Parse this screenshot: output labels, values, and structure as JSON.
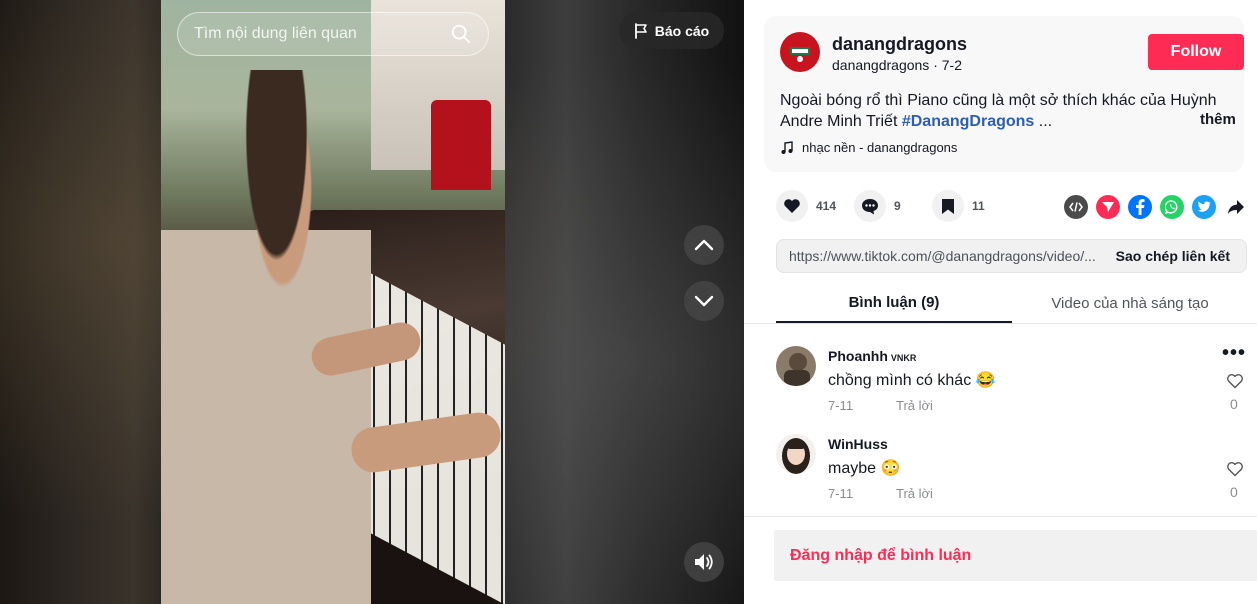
{
  "video": {
    "search_placeholder": "Tìm nội dung liên quan",
    "report_label": "Báo cáo"
  },
  "post": {
    "username": "danangdragons",
    "handle": "danangdragons",
    "date": "7-2",
    "follow_label": "Follow",
    "description": "Ngoài bóng rổ thì Piano cũng là một sở thích khác của Huỳnh Andre Minh Triết",
    "hashtag": "#DanangDragons",
    "ellipsis": " ...",
    "more_label": "thêm",
    "music": "nhạc nền - danangdragons"
  },
  "actions": {
    "likes": "414",
    "comments": "9",
    "saves": "11"
  },
  "share": {
    "icons": [
      "embed-icon",
      "send-icon",
      "facebook-icon",
      "whatsapp-icon",
      "twitter-icon",
      "share-arrow-icon"
    ],
    "colors": {
      "embed": "#4b4b4b",
      "send": "#fe2c55",
      "facebook": "#0075fa",
      "whatsapp": "#25d366",
      "twitter": "#1da1f2"
    }
  },
  "link": {
    "url": "https://www.tiktok.com/@danangdragons/video/...",
    "copy_label": "Sao chép liên kết"
  },
  "tabs": {
    "comments": "Bình luận (9)",
    "creator_videos": "Video của nhà sáng tạo"
  },
  "comments": [
    {
      "name": "Phoanhh",
      "badge": "VNKR",
      "text": "chồng mình có khác 😂",
      "date": "7-11",
      "reply": "Trả lời",
      "likes": "0"
    },
    {
      "name": "WinHuss",
      "badge": "",
      "text": "maybe 😳",
      "date": "7-11",
      "reply": "Trả lời",
      "likes": "0"
    }
  ],
  "login_prompt": "Đăng nhập để bình luận",
  "colors": {
    "accent": "#fe2c55",
    "hashtag": "#2b5db9"
  }
}
